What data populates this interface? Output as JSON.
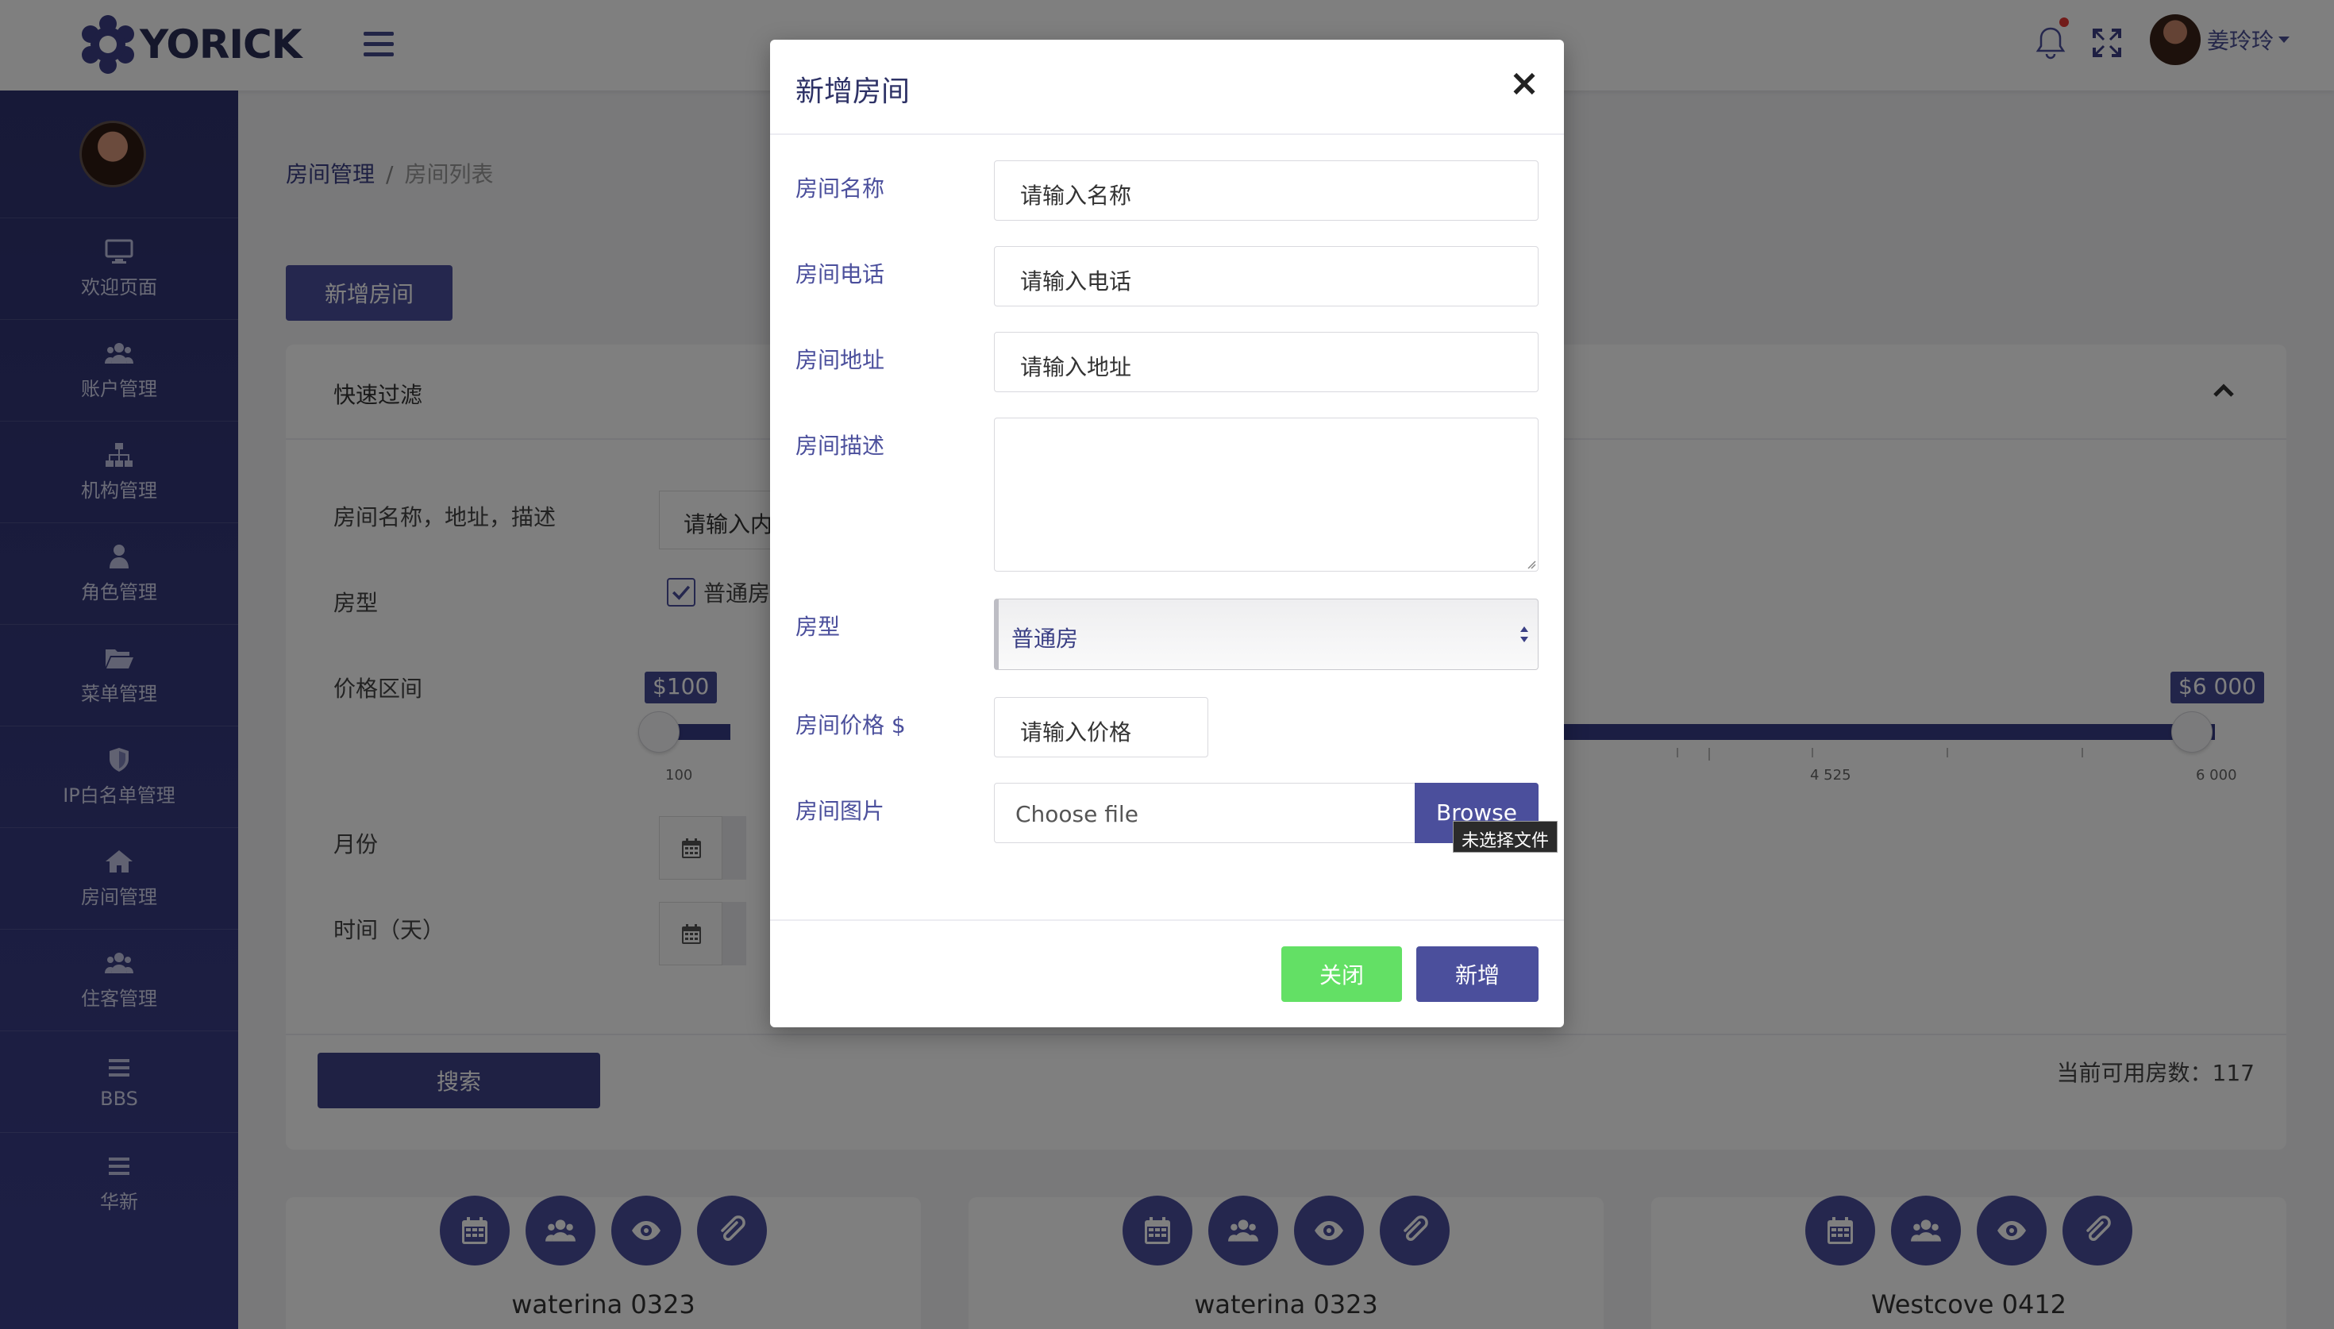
{
  "header": {
    "logo_text": "YORICK",
    "user_name": "姜玲玲"
  },
  "sidebar": {
    "items": [
      {
        "label": "欢迎页面",
        "icon": "monitor-icon"
      },
      {
        "label": "账户管理",
        "icon": "users-icon"
      },
      {
        "label": "机构管理",
        "icon": "sitemap-icon"
      },
      {
        "label": "角色管理",
        "icon": "user-icon"
      },
      {
        "label": "菜单管理",
        "icon": "folder-open-icon"
      },
      {
        "label": "IP白名单管理",
        "icon": "shield-icon"
      },
      {
        "label": "房间管理",
        "icon": "home-icon"
      },
      {
        "label": "住客管理",
        "icon": "users-icon"
      },
      {
        "label": "BBS",
        "icon": "list-icon"
      },
      {
        "label": "华新",
        "icon": "list-icon"
      }
    ]
  },
  "breadcrumb": {
    "parent": "房间管理",
    "separator": "/",
    "current": "房间列表"
  },
  "main": {
    "add_room_button": "新增房间"
  },
  "filter": {
    "title": "快速过滤",
    "labels": {
      "name_addr_desc": "房间名称，地址，描述",
      "room_type": "房型",
      "price_range": "价格区间",
      "month": "月份",
      "time_days": "时间（天）"
    },
    "search_placeholder_visible": "请输入内",
    "room_type_option": "普通房",
    "room_type_checked": true,
    "price_min_label": "$100",
    "price_max_label": "$6 000",
    "price_min_value": 100,
    "price_max_value": 6000,
    "ticks": [
      "100",
      "4 525",
      "6 000"
    ],
    "search_button": "搜索",
    "available_rooms": "当前可用房数：117"
  },
  "cards": [
    {
      "title": "waterina 0323"
    },
    {
      "title": "waterina 0323"
    },
    {
      "title": "Westcove 0412"
    }
  ],
  "card_icons": [
    "calendar-icon",
    "users-icon",
    "eye-icon",
    "paperclip-icon"
  ],
  "modal": {
    "title": "新增房间",
    "close_symbol": "×",
    "fields": {
      "name_label": "房间名称",
      "name_placeholder": "请输入名称",
      "phone_label": "房间电话",
      "phone_placeholder": "请输入电话",
      "address_label": "房间地址",
      "address_placeholder": "请输入地址",
      "desc_label": "房间描述",
      "type_label": "房型",
      "type_value": "普通房",
      "price_label": "房间价格 $",
      "price_placeholder": "请输入价格",
      "image_label": "房间图片",
      "file_placeholder": "Choose file",
      "browse": "Browse",
      "file_tooltip": "未选择文件"
    },
    "close_button": "关闭",
    "submit_button": "新增"
  },
  "colors": {
    "brand": "#4b4f9c",
    "sidebar": "#2f3370",
    "success": "#63e065",
    "notify_dot": "#e53935"
  }
}
